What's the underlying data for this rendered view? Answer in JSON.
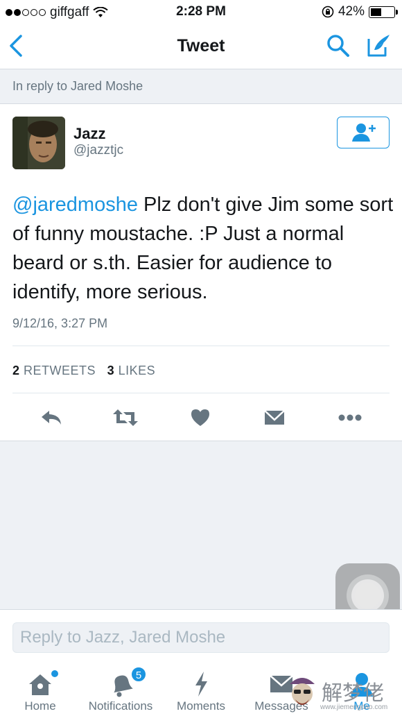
{
  "status_bar": {
    "carrier": "giffgaff",
    "time": "2:28 PM",
    "battery": "42%"
  },
  "nav": {
    "title": "Tweet"
  },
  "context": {
    "text": "In reply to Jared Moshe"
  },
  "tweet": {
    "name": "Jazz",
    "handle": "@jazztjc",
    "mention": "@jaredmoshe",
    "body": " Plz don't give Jim some sort of funny moustache. :P Just a normal beard or s.th. Easier for audience to identify, more serious.",
    "timestamp": "9/12/16, 3:27 PM",
    "retweets_count": "2",
    "retweets_label": "RETWEETS",
    "likes_count": "3",
    "likes_label": "LIKES"
  },
  "reply": {
    "placeholder": "Reply to Jazz, Jared Moshe"
  },
  "tabs": [
    {
      "label": "Home",
      "icon": "home-icon"
    },
    {
      "label": "Notifications",
      "icon": "bell-icon",
      "badge": "5"
    },
    {
      "label": "Moments",
      "icon": "lightning-icon"
    },
    {
      "label": "Messages",
      "icon": "envelope-icon"
    },
    {
      "label": "Me",
      "icon": "person-icon"
    }
  ],
  "watermark": {
    "text": "解梦佬",
    "url": "www.jiemengdao.com"
  },
  "colors": {
    "accent": "#1b95e0",
    "icon_gray": "#667580",
    "background": "#eef1f5"
  }
}
